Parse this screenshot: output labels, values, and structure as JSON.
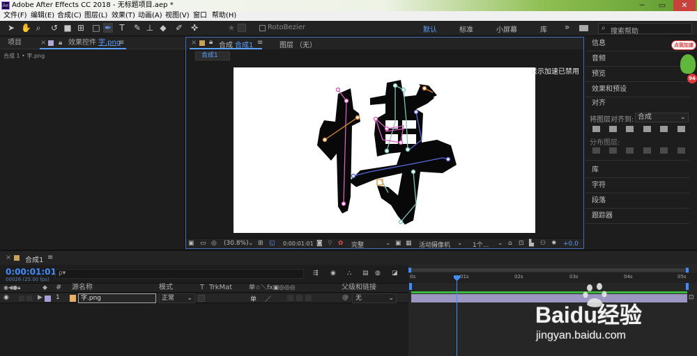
{
  "window": {
    "title": "Adobe After Effects CC 2018 - 无标题项目.aep *",
    "logo": "Ae",
    "controls": [
      "─",
      "▭",
      "✕"
    ]
  },
  "menu": [
    "文件(F)",
    "编辑(E)",
    "合成(C)",
    "图层(L)",
    "效果(T)",
    "动画(A)",
    "视图(V)",
    "窗口",
    "帮助(H)"
  ],
  "toolbar": {
    "rotobezier": "RotoBezier",
    "workspaces": [
      "默认",
      "标准",
      "小屏幕",
      "库"
    ],
    "expand": "»",
    "search_placeholder": "搜索帮助"
  },
  "project_panel": {
    "tab_project": "项目",
    "tab_effects": "效果控件",
    "tab_effects_file": "字.png",
    "menu": "≡",
    "breadcrumb": "合成 1 • 字.png"
  },
  "comp_panel": {
    "tab_comp": "合成",
    "tab_comp_name": "合成1",
    "tab_layer": "图层",
    "tab_layer_value": "（无）",
    "subtab": "合成1",
    "accel_notice": "显示加速已禁用"
  },
  "viewer_bar": {
    "zoom": "(30.8%)",
    "timecode": "0:00:01:01",
    "quality": "完整",
    "camera": "活动摄像机",
    "views": "1个...",
    "exposure": "+0.0"
  },
  "right_panel": {
    "items_top": [
      "信息",
      "音频",
      "预览",
      "效果和预设"
    ],
    "align_title": "对齐",
    "align_to_label": "将图层对齐到:",
    "align_to_value": "合成",
    "distribute_label": "分布图层:",
    "items_bottom": [
      "库",
      "字符",
      "段落",
      "跟踪器"
    ]
  },
  "timeline": {
    "tab": "合成1",
    "timecode": "0:00:01:01",
    "frames": "00026 (25.00 fps)",
    "search_placeholder": "ρ▾",
    "columns": {
      "name": "源名称",
      "mode": "模式",
      "t": "T",
      "trkmat": "TrkMat",
      "switches": "单☆＼fx▣◎◎◎",
      "parent": "父级和链接"
    },
    "layer": {
      "index": "1",
      "name": "字.png",
      "mode": "正常",
      "parent": "无"
    },
    "ruler": [
      "0s",
      "01s",
      "02s",
      "03s",
      "04s",
      "05s"
    ],
    "current_time_fraction": 0.165
  },
  "watermark": {
    "brand": "Baidu经验",
    "url": "jingyan.baidu.com"
  },
  "badge": {
    "label": "点我加速",
    "value": "94"
  },
  "canvas": {
    "character": "博",
    "colors": {
      "ink": "#080808",
      "pink": "#d65fc0",
      "orange": "#e08a2a",
      "blue": "#5a6ae0",
      "teal": "#7fc7b8"
    }
  }
}
